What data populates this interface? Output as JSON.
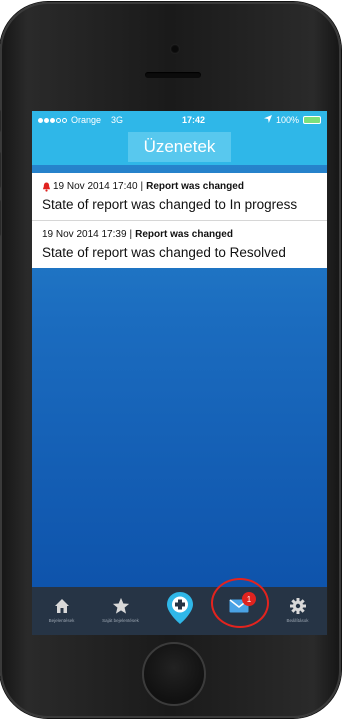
{
  "status_bar": {
    "carrier": "Orange",
    "network": "3G",
    "time": "17:42",
    "battery": "100%"
  },
  "nav": {
    "title": "Üzenetek"
  },
  "messages": [
    {
      "date": "19 Nov 2014 17:40",
      "separator": "|",
      "title": "Report was changed",
      "body": "State of report was changed to In progress",
      "has_alert_icon": true
    },
    {
      "date": "19 Nov 2014 17:39",
      "separator": "|",
      "title": "Report was changed",
      "body": "State of report was changed to Resolved",
      "has_alert_icon": false
    }
  ],
  "tab_bar": {
    "items": [
      {
        "label": "Bejelentések",
        "icon": "home-icon"
      },
      {
        "label": "Saját bejelentések",
        "icon": "star-icon"
      },
      {
        "label": "",
        "icon": "add-report-pin-icon"
      },
      {
        "label": "",
        "icon": "mail-icon",
        "badge": "1"
      },
      {
        "label": "Beállítások",
        "icon": "gear-icon"
      }
    ]
  },
  "colors": {
    "accent": "#2fb7e8",
    "tab_bar": "#263445",
    "badge": "#e0231f",
    "highlight": "#e3231e"
  }
}
